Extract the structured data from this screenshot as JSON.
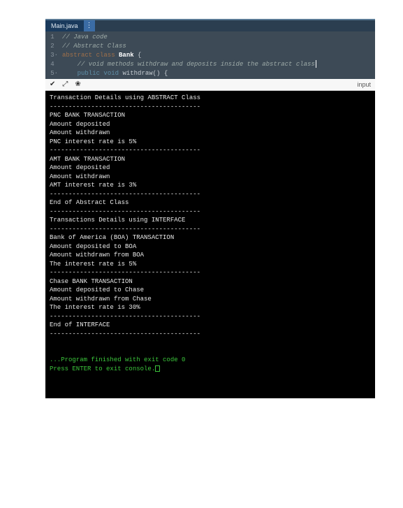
{
  "tab": {
    "label": "Main.java",
    "menu_glyph": "⋮"
  },
  "code": {
    "lines": [
      {
        "num": "1",
        "text": "// Java code",
        "cls": "comment"
      },
      {
        "num": "2",
        "text": "// Abstract Class",
        "cls": "comment"
      },
      {
        "num": "3",
        "prefix": "abstract class ",
        "name": "Bank",
        "suffix": " {",
        "compound": true,
        "marker": "·"
      },
      {
        "num": "4",
        "text": "    // void methods withdraw and deposits inside the abstract class",
        "cls": "comment",
        "cursor": true
      },
      {
        "num": "5",
        "kw1": "    public ",
        "kw2": "void ",
        "rest": "withdraw() {",
        "line5": true,
        "marker": "·"
      }
    ]
  },
  "toolbar": {
    "icons": {
      "i1": "✔",
      "i2": "⤢",
      "i3": "❀"
    },
    "input_label": "input"
  },
  "console": {
    "lines": [
      "Transaction Details using ABSTRACT Class",
      "----------------------------------------",
      "PNC BANK TRANSACTION",
      "Amount deposited",
      "Amount withdrawn",
      "PNC interest rate is 5%",
      "----------------------------------------",
      "AMT BANK TRANSACTION",
      "Amount deposited",
      "Amount withdrawn",
      "AMT interest rate is 3%",
      "----------------------------------------",
      "End of Abstract Class",
      "----------------------------------------",
      "Transactions Details using INTERFACE",
      "----------------------------------------",
      "Bank of America (BOA) TRANSACTION",
      "Amount deposited to BOA",
      "Amount withdrawn from BOA",
      "The interest rate is 5%",
      "----------------------------------------",
      "Chase BANK TRANSACTION",
      "Amount deposited to Chase",
      "Amount withdrawn from Chase",
      "The interest rate is 30%",
      "----------------------------------------",
      "End of INTERFACE",
      "----------------------------------------",
      "",
      ""
    ],
    "exit_line": "...Program finished with exit code 0",
    "prompt_line": "Press ENTER to exit console."
  }
}
